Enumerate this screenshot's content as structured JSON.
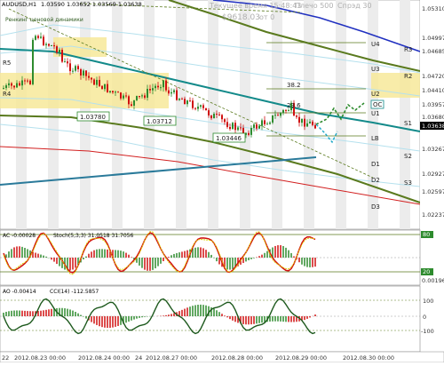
{
  "header": {
    "symbol": "AUDUSD,H1",
    "ohlc": "1.03590 1.03652 1.03569 1.03638",
    "indicator_note": "Ренкинг ценовой динамики",
    "server_time": "Текущее время 15:48:43",
    "leverage": "Плечо 500",
    "spread": "Спрэд 30",
    "balance": "$9618.03",
    "balance_suffix": "от 0"
  },
  "price_axis": [
    "1.05310",
    "1.04997",
    "1.04685",
    "1.04720",
    "1.04410",
    "1.03957",
    "1.03680",
    "1.03638",
    "1.03267",
    "1.02927",
    "1.02597",
    "1.02237"
  ],
  "current_price": "1.03638",
  "levels": [
    {
      "name": "U4"
    },
    {
      "name": "U3"
    },
    {
      "name": "U2"
    },
    {
      "name": "U1"
    },
    {
      "name": "LB"
    },
    {
      "name": "D1"
    },
    {
      "name": "D2"
    },
    {
      "name": "D3"
    },
    {
      "name": "R5"
    },
    {
      "name": "R4"
    },
    {
      "name": "R3"
    },
    {
      "name": "R2"
    },
    {
      "name": "S1"
    },
    {
      "name": "S2"
    },
    {
      "name": "S3"
    }
  ],
  "fib_labels": {
    "f382": "38.2",
    "f236": "23.6",
    "oc": "OC",
    "r2": "R2"
  },
  "low_labels": {
    "low1": "1.03780",
    "low2": "1.03712",
    "low3": "1.03446"
  },
  "ac_panel": {
    "label": "AC -0.00028",
    "stoch": "Stoch(5,3,3) 31.0518 31.7056",
    "axis": [
      "80",
      "20",
      "0.00196"
    ]
  },
  "ao_panel": {
    "label": "AO -0.00414",
    "cci": "CCI(14) -112.5857",
    "axis": [
      "100",
      "0",
      "-100"
    ]
  },
  "time_axis": [
    "22",
    "2012.08.23 00:00",
    "2012.08.24 00:00",
    "24",
    "2012.08.27 00:00",
    "2012.08.28 00:00",
    "2012.08.29 00:00",
    "2012.08.30 00:00"
  ],
  "colors": {
    "bull": "#2e8b2e",
    "bear": "#d01010",
    "olive": "#5a7a1e",
    "teal": "#138a8a",
    "blue": "#2030c0",
    "yellow": "#f7e99a",
    "red": "#d22020"
  }
}
